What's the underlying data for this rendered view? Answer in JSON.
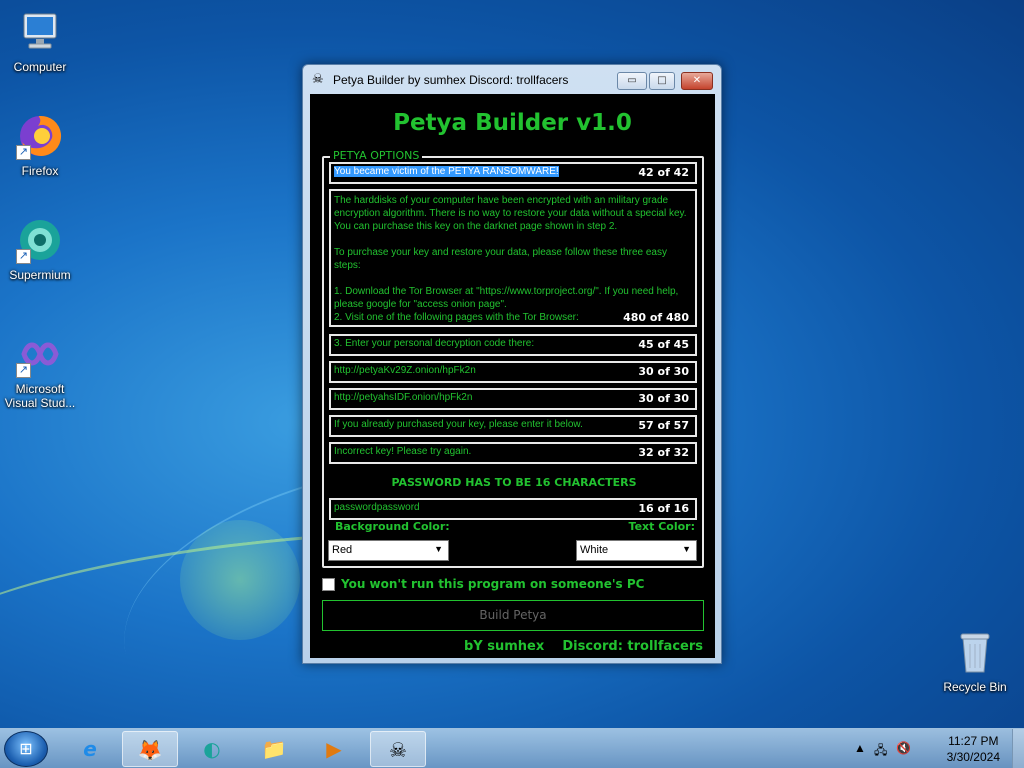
{
  "desktop": {
    "icons": [
      {
        "label": "Computer",
        "glyph": "🖥"
      },
      {
        "label": "Firefox",
        "glyph": "🦊"
      },
      {
        "label": "Supermium",
        "glyph": "◐"
      },
      {
        "label": "Microsoft Visual Stud...",
        "glyph": "∞"
      },
      {
        "label": "Recycle Bin",
        "glyph": "🗑"
      }
    ]
  },
  "window": {
    "title": "Petya Builder by sumhex Discord: trollfacers",
    "buttons": {
      "minimize": "▭",
      "maximize": "□",
      "close": "✕"
    }
  },
  "app": {
    "heading": "Petya Builder v1.0",
    "group_label": "PETYA OPTIONS",
    "fields": [
      {
        "text": "You became victim of the PETYA RANSOMWARE!",
        "count": "42 of 42"
      },
      {
        "text": "The harddisks of your computer have been encrypted with an military grade encryption algorithm. There is no way to restore your data without a special key. You can purchase this key on the darknet page shown in step 2.\n\nTo purchase your key and restore your data, please follow these three easy steps:\n\n1. Download the Tor Browser at \"https://www.torproject.org/\". If you need help, please google for \"access onion page\".\n2. Visit one of the following pages with the Tor Browser:",
        "count": "480 of 480"
      },
      {
        "text": "3. Enter your personal decryption code there:",
        "count": "45 of 45"
      },
      {
        "text": "http://petyaKv29Z.onion/hpFk2n",
        "count": "30 of 30"
      },
      {
        "text": "http://petyahsIDF.onion/hpFk2n",
        "count": "30 of 30"
      },
      {
        "text": "If you already purchased your key, please enter it below.",
        "count": "57 of 57"
      },
      {
        "text": "Incorrect key! Please try again.",
        "count": "32 of 32"
      }
    ],
    "password_label": "PASSWORD HAS TO BE 16 CHARACTERS",
    "password": {
      "value": "passwordpassword",
      "count": "16 of 16"
    },
    "background_color_label": "Background Color:",
    "text_color_label": "Text Color:",
    "background_color_value": "Red",
    "text_color_value": "White",
    "checkbox_label": "You won't run this program on someone's PC",
    "checkbox_checked": false,
    "build_button": "Build Petya",
    "footer_author": "bY sumhex",
    "footer_discord": "Discord: trollfacers"
  },
  "taskbar": {
    "start_glyph": "⊞",
    "items": [
      "e",
      "🦊",
      "◐",
      "📁",
      "▶",
      "☠"
    ],
    "clock_time": "11:27 PM",
    "clock_date": "3/30/2024"
  },
  "colors": {
    "accent_green": "#22c230",
    "window_bg": "#000000"
  }
}
